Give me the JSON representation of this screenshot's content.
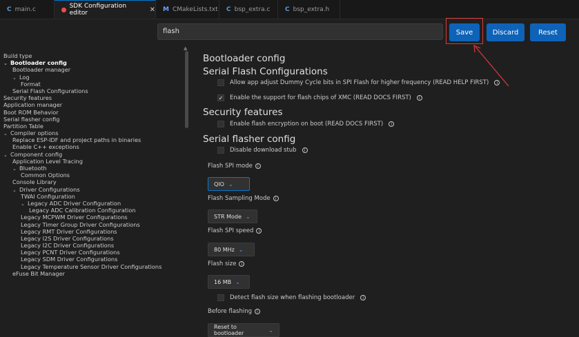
{
  "tabs": [
    {
      "label": "main.c",
      "icon": "c-file-icon",
      "glyph": "C"
    },
    {
      "label": "SDK Configuration editor",
      "icon": "modified-dot-icon",
      "active": true
    },
    {
      "label": "CMakeLists.txt",
      "icon": "m-file-icon",
      "glyph": "M"
    },
    {
      "label": "bsp_extra.c",
      "icon": "c-file-icon",
      "glyph": "C"
    },
    {
      "label": "bsp_extra.h",
      "icon": "c-file-icon",
      "glyph": "C"
    }
  ],
  "close_glyph": "✕",
  "search": {
    "value": "flash"
  },
  "toolbar": {
    "save_label": "Save",
    "discard_label": "Discard",
    "reset_label": "Reset"
  },
  "tree": [
    {
      "label": "Build type",
      "indent": 0
    },
    {
      "label": "Bootloader config",
      "indent": 0,
      "chev": true,
      "bold": true
    },
    {
      "label": "Bootloader manager",
      "indent": 1
    },
    {
      "label": "Log",
      "indent": 1,
      "chev": true
    },
    {
      "label": "Format",
      "indent": 2
    },
    {
      "label": "Serial Flash Configurations",
      "indent": 1
    },
    {
      "label": "Security features",
      "indent": 0
    },
    {
      "label": "Application manager",
      "indent": 0
    },
    {
      "label": "Boot ROM Behavior",
      "indent": 0
    },
    {
      "label": "Serial flasher config",
      "indent": 0
    },
    {
      "label": "Partition Table",
      "indent": 0
    },
    {
      "label": "Compiler options",
      "indent": 0,
      "chev": true
    },
    {
      "label": "Replace ESP-IDF and project paths in binaries",
      "indent": 1
    },
    {
      "label": "Enable C++ exceptions",
      "indent": 1
    },
    {
      "label": "Component config",
      "indent": 0,
      "chev": true
    },
    {
      "label": "Application Level Tracing",
      "indent": 1
    },
    {
      "label": "Bluetooth",
      "indent": 1,
      "chev": true
    },
    {
      "label": "Common Options",
      "indent": 2
    },
    {
      "label": "Console Library",
      "indent": 1
    },
    {
      "label": "Driver Configurations",
      "indent": 1,
      "chev": true
    },
    {
      "label": "TWAI Configuration",
      "indent": 2
    },
    {
      "label": "Legacy ADC Driver Configuration",
      "indent": 2,
      "chev": true
    },
    {
      "label": "Legacy ADC Calibration Configuration",
      "indent": 3
    },
    {
      "label": "Legacy MCPWM Driver Configurations",
      "indent": 2
    },
    {
      "label": "Legacy Timer Group Driver Configurations",
      "indent": 2
    },
    {
      "label": "Legacy RMT Driver Configurations",
      "indent": 2
    },
    {
      "label": "Legacy I2S Driver Configurations",
      "indent": 2
    },
    {
      "label": "Legacy I2C Driver Configurations",
      "indent": 2
    },
    {
      "label": "Legacy PCNT Driver Configurations",
      "indent": 2
    },
    {
      "label": "Legacy SDM Driver Configurations",
      "indent": 2
    },
    {
      "label": "Legacy Temperature Sensor Driver Configurations",
      "indent": 2
    },
    {
      "label": "eFuse Bit Manager",
      "indent": 1
    }
  ],
  "content": {
    "bootloader_config": "Bootloader config",
    "serial_flash_configurations": "Serial Flash Configurations",
    "allow_dummy_cycle": "Allow app adjust Dummy Cycle bits in SPI Flash for higher frequency (READ HELP FIRST)",
    "enable_xmc": "Enable the support for flash chips of XMC (READ DOCS FIRST)",
    "security_features": "Security features",
    "enable_flash_encryption": "Enable flash encryption on boot (READ DOCS FIRST)",
    "serial_flasher_config": "Serial flasher config",
    "disable_download_stub": "Disable download stub",
    "flash_spi_mode_label": "Flash SPI mode",
    "flash_spi_mode_value": "QIO",
    "flash_sampling_mode_label": "Flash Sampling Mode",
    "flash_sampling_mode_value": "STR Mode",
    "flash_spi_speed_label": "Flash SPI speed",
    "flash_spi_speed_value": "80 MHz",
    "flash_size_label": "Flash size",
    "flash_size_value": "16 MB",
    "detect_flash_size": "Detect flash size when flashing bootloader",
    "before_flashing_label": "Before flashing",
    "before_flashing_value": "Reset to bootloader"
  },
  "checks": {
    "allow_dummy_cycle": false,
    "enable_xmc": true,
    "enable_flash_encryption": false,
    "disable_download_stub": false,
    "detect_flash_size": false
  },
  "glyphs": {
    "check": "✓",
    "info": "i",
    "caret": "⌄",
    "chev_down": "⌄",
    "scroll_up": "▲"
  },
  "colors": {
    "accent": "#0e63b8",
    "annotation": "#e03a3a"
  }
}
